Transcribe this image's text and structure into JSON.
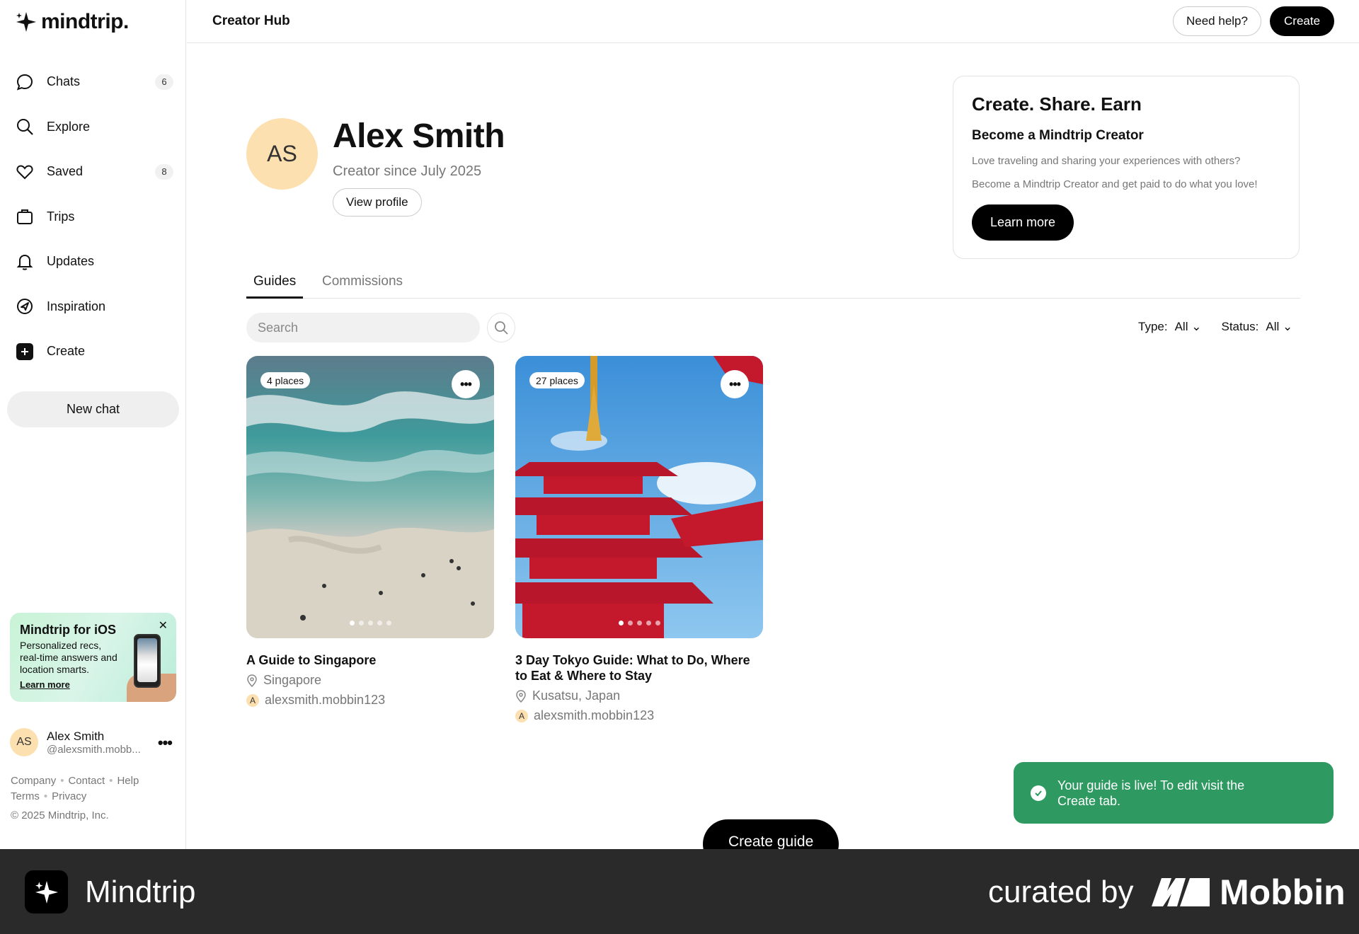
{
  "app": {
    "logo_text": "mindtrip.",
    "page_title": "Creator Hub"
  },
  "header": {
    "help_label": "Need help?",
    "create_label": "Create"
  },
  "sidebar": {
    "items": [
      {
        "label": "Chats",
        "icon": "chat-icon",
        "badge": "6"
      },
      {
        "label": "Explore",
        "icon": "search-icon",
        "badge": ""
      },
      {
        "label": "Saved",
        "icon": "heart-icon",
        "badge": "8"
      },
      {
        "label": "Trips",
        "icon": "suitcase-icon",
        "badge": ""
      },
      {
        "label": "Updates",
        "icon": "bell-icon",
        "badge": ""
      },
      {
        "label": "Inspiration",
        "icon": "compass-icon",
        "badge": ""
      },
      {
        "label": "Create",
        "icon": "plus-icon",
        "badge": ""
      }
    ],
    "new_chat_label": "New chat",
    "ios_card": {
      "title": "Mindtrip for iOS",
      "desc": "Personalized recs, real-time answers and location smarts.",
      "link": "Learn more",
      "close": "✕"
    },
    "user": {
      "initials": "AS",
      "name": "Alex Smith",
      "handle": "@alexsmith.mobb...",
      "more": "•••"
    },
    "footer": {
      "company": "Company",
      "contact": "Contact",
      "help": "Help",
      "terms": "Terms",
      "privacy": "Privacy",
      "copyright": "© 2025 Mindtrip, Inc."
    }
  },
  "profile": {
    "initials": "AS",
    "name": "Alex Smith",
    "since": "Creator since July 2025",
    "view_label": "View profile"
  },
  "promo": {
    "title": "Create. Share. Earn",
    "subtitle": "Become a Mindtrip Creator",
    "text1": "Love traveling and sharing your experiences with others?",
    "text2": "Become a Mindtrip Creator and get paid to do what you love!",
    "button": "Learn more"
  },
  "tabs": {
    "guides": "Guides",
    "commissions": "Commissions"
  },
  "search": {
    "placeholder": "Search"
  },
  "filters": {
    "type_label": "Type:",
    "type_value": "All",
    "status_label": "Status:",
    "status_value": "All"
  },
  "guides": [
    {
      "places": "4 places",
      "title": "A Guide to Singapore",
      "location": "Singapore",
      "author": "alexsmith.mobbin123",
      "author_initial": "A",
      "more": "•••"
    },
    {
      "places": "27 places",
      "title": "3 Day Tokyo Guide: What to Do, Where to Eat & Where to Stay",
      "location": "Kusatsu, Japan",
      "author": "alexsmith.mobbin123",
      "author_initial": "A",
      "more": "•••"
    }
  ],
  "toast": {
    "text": "Your guide is live! To edit visit the Create tab."
  },
  "create_guide_label": "Create guide",
  "banner": {
    "name": "Mindtrip",
    "curated": "curated by",
    "mobbin": "Mobbin"
  },
  "colors": {
    "accent": "#000000",
    "toast": "#2e9a62",
    "avatar": "#fde0b0",
    "banner": "#2a2a2a"
  }
}
